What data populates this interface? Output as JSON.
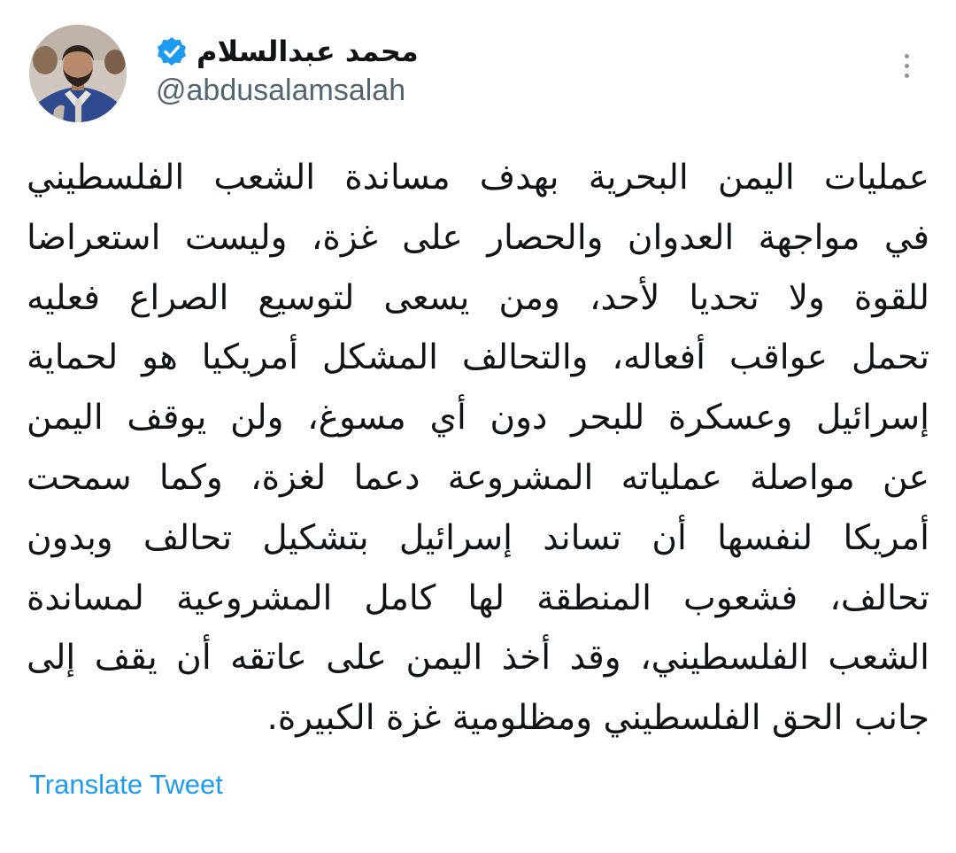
{
  "tweet": {
    "author": {
      "display_name": "محمد عبدالسلام",
      "handle": "@abdusalamsalah",
      "verified": true,
      "avatar": "profile-photo"
    },
    "more_icon": "more-vertical-icon",
    "text_lines": [
      "عمليات اليمن البحرية بهدف مساندة الشعب الفلسطيني",
      "في مواجهة العدوان والحصار على غزة، وليست استعراضا",
      "للقوة ولا تحديا لأحد، ومن يسعى لتوسيع الصراع فعليه",
      "تحمل عواقب أفعاله، والتحالف المشكل أمريكيا هو لحماية",
      "إسرائيل وعسكرة للبحر دون أي مسوغ، ولن يوقف اليمن",
      "عن مواصلة عملياته المشروعة دعما لغزة، وكما سمحت",
      "أمريكا لنفسها أن تساند إسرائيل بتشكيل تحالف وبدون",
      "تحالف، فشعوب المنطقة لها كامل المشروعية لمساندة",
      "الشعب الفلسطيني، وقد أخذ اليمن على عاتقه أن يقف إلى",
      "جانب الحق الفلسطيني ومظلومية غزة الكبيرة."
    ],
    "translate_label": "Translate Tweet"
  },
  "colors": {
    "text": "#0f1419",
    "secondary": "#536471",
    "link": "#1d9bf0",
    "verified_badge": "#1d9bf0",
    "background": "#ffffff"
  }
}
